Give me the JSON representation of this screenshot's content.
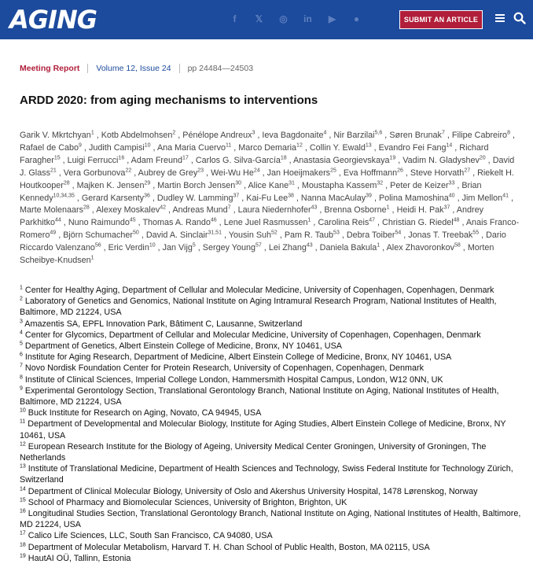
{
  "header": {
    "logo": "AGING",
    "social": [
      "facebook-icon",
      "x-icon",
      "instagram-icon",
      "linkedin-icon",
      "youtube-icon",
      "reddit-icon"
    ],
    "submit_label": "SUBMIT AN ARTICLE"
  },
  "meta": {
    "type": "Meeting Report",
    "volume": "Volume 12, Issue 24",
    "pages": "pp 24484—24503"
  },
  "title": "ARDD 2020: from aging mechanisms to interventions",
  "authors": [
    {
      "name": "Garik V. Mkrtchyan",
      "aff": "1"
    },
    {
      "name": "Kotb Abdelmohsen",
      "aff": "2"
    },
    {
      "name": "Pénélope Andreux",
      "aff": "3"
    },
    {
      "name": "Ieva Bagdonaite",
      "aff": "4"
    },
    {
      "name": "Nir Barzilai",
      "aff": "5,6"
    },
    {
      "name": "Søren Brunak",
      "aff": "7"
    },
    {
      "name": "Filipe Cabreiro",
      "aff": "8"
    },
    {
      "name": "Rafael de Cabo",
      "aff": "9"
    },
    {
      "name": "Judith Campisi",
      "aff": "10"
    },
    {
      "name": "Ana Maria Cuervo",
      "aff": "11"
    },
    {
      "name": "Marco Demaria",
      "aff": "12"
    },
    {
      "name": "Collin Y. Ewald",
      "aff": "13"
    },
    {
      "name": "Evandro Fei Fang",
      "aff": "14"
    },
    {
      "name": "Richard Faragher",
      "aff": "15"
    },
    {
      "name": "Luigi Ferrucci",
      "aff": "16"
    },
    {
      "name": "Adam Freund",
      "aff": "17"
    },
    {
      "name": "Carlos G. Silva-García",
      "aff": "18"
    },
    {
      "name": "Anastasia Georgievskaya",
      "aff": "19"
    },
    {
      "name": "Vadim N. Gladyshev",
      "aff": "20"
    },
    {
      "name": "David J. Glass",
      "aff": "21"
    },
    {
      "name": "Vera Gorbunova",
      "aff": "22"
    },
    {
      "name": "Aubrey de Grey",
      "aff": "23"
    },
    {
      "name": "Wei-Wu He",
      "aff": "24"
    },
    {
      "name": "Jan Hoeijmakers",
      "aff": "25"
    },
    {
      "name": "Eva Hoffmann",
      "aff": "26"
    },
    {
      "name": "Steve Horvath",
      "aff": "27"
    },
    {
      "name": "Riekelt H. Houtkooper",
      "aff": "28"
    },
    {
      "name": "Majken K. Jensen",
      "aff": "29"
    },
    {
      "name": "Martin Borch Jensen",
      "aff": "30"
    },
    {
      "name": "Alice Kane",
      "aff": "31"
    },
    {
      "name": "Moustapha Kassem",
      "aff": "32"
    },
    {
      "name": "Peter de Keizer",
      "aff": "33"
    },
    {
      "name": "Brian Kennedy",
      "aff": "10,34,35"
    },
    {
      "name": "Gerard Karsenty",
      "aff": "36"
    },
    {
      "name": "Dudley W. Lamming",
      "aff": "37"
    },
    {
      "name": "Kai-Fu Lee",
      "aff": "38"
    },
    {
      "name": "Nanna MacAulay",
      "aff": "39"
    },
    {
      "name": "Polina Mamoshina",
      "aff": "40"
    },
    {
      "name": "Jim Mellon",
      "aff": "41"
    },
    {
      "name": "Marte Molenaars",
      "aff": "28"
    },
    {
      "name": "Alexey Moskalev",
      "aff": "42"
    },
    {
      "name": "Andreas Mund",
      "aff": "7"
    },
    {
      "name": "Laura Niedernhofer",
      "aff": "43"
    },
    {
      "name": "Brenna Osborne",
      "aff": "1"
    },
    {
      "name": "Heidi H. Pak",
      "aff": "37"
    },
    {
      "name": "Andrey Parkhitko",
      "aff": "44"
    },
    {
      "name": "Nuno Raimundo",
      "aff": "45"
    },
    {
      "name": "Thomas A. Rando",
      "aff": "46"
    },
    {
      "name": "Lene Juel Rasmussen",
      "aff": "1"
    },
    {
      "name": "Carolina Reis",
      "aff": "47"
    },
    {
      "name": "Christian G. Riedel",
      "aff": "48"
    },
    {
      "name": "Anais Franco-Romero",
      "aff": "49"
    },
    {
      "name": "Björn Schumacher",
      "aff": "50"
    },
    {
      "name": "David A. Sinclair",
      "aff": "31,51"
    },
    {
      "name": "Yousin Suh",
      "aff": "52"
    },
    {
      "name": "Pam R. Taub",
      "aff": "53"
    },
    {
      "name": "Debra Toiber",
      "aff": "54"
    },
    {
      "name": "Jonas T. Treebak",
      "aff": "55"
    },
    {
      "name": "Dario Riccardo Valenzano",
      "aff": "56"
    },
    {
      "name": "Eric Verdin",
      "aff": "10"
    },
    {
      "name": "Jan Vijg",
      "aff": "5"
    },
    {
      "name": "Sergey Young",
      "aff": "57"
    },
    {
      "name": "Lei Zhang",
      "aff": "43"
    },
    {
      "name": "Daniela Bakula",
      "aff": "1"
    },
    {
      "name": "Alex Zhavoronkov",
      "aff": "58"
    },
    {
      "name": "Morten Scheibye-Knudsen",
      "aff": "1"
    }
  ],
  "affiliations": [
    {
      "num": "1",
      "text": "Center for Healthy Aging, Department of Cellular and Molecular Medicine, University of Copenhagen, Copenhagen, Denmark"
    },
    {
      "num": "2",
      "text": "Laboratory of Genetics and Genomics, National Institute on Aging Intramural Research Program, National Institutes of Health, Baltimore, MD 21224, USA"
    },
    {
      "num": "3",
      "text": "Amazentis SA, EPFL Innovation Park, Bâtiment C, Lausanne, Switzerland"
    },
    {
      "num": "4",
      "text": "Center for Glycomics, Department of Cellular and Molecular Medicine, University of Copenhagen, Copenhagen, Denmark"
    },
    {
      "num": "5",
      "text": "Department of Genetics, Albert Einstein College of Medicine, Bronx, NY 10461, USA"
    },
    {
      "num": "6",
      "text": "Institute for Aging Research, Department of Medicine, Albert Einstein College of Medicine, Bronx, NY 10461, USA"
    },
    {
      "num": "7",
      "text": "Novo Nordisk Foundation Center for Protein Research, University of Copenhagen, Copenhagen, Denmark"
    },
    {
      "num": "8",
      "text": "Institute of Clinical Sciences, Imperial College London, Hammersmith Hospital Campus, London, W12 0NN, UK"
    },
    {
      "num": "9",
      "text": "Experimental Gerontology Section, Translational Gerontology Branch, National Institute on Aging, National Institutes of Health, Baltimore, MD 21224, USA"
    },
    {
      "num": "10",
      "text": "Buck Institute for Research on Aging, Novato, CA 94945, USA"
    },
    {
      "num": "11",
      "text": "Department of Developmental and Molecular Biology, Institute for Aging Studies, Albert Einstein College of Medicine, Bronx, NY 10461, USA"
    },
    {
      "num": "12",
      "text": "European Research Institute for the Biology of Ageing, University Medical Center Groningen, University of Groningen, The Netherlands"
    },
    {
      "num": "13",
      "text": "Institute of Translational Medicine, Department of Health Sciences and Technology, Swiss Federal Institute for Technology Zürich, Switzerland"
    },
    {
      "num": "14",
      "text": "Department of Clinical Molecular Biology, University of Oslo and Akershus University Hospital, 1478 Lørenskog, Norway"
    },
    {
      "num": "15",
      "text": "School of Pharmacy and Biomolecular Sciences, University of Brighton, Brighton, UK"
    },
    {
      "num": "16",
      "text": "Longitudinal Studies Section, Translational Gerontology Branch, National Institute on Aging, National Institutes of Health, Baltimore, MD 21224, USA"
    },
    {
      "num": "17",
      "text": "Calico Life Sciences, LLC, South San Francisco, CA 94080, USA"
    },
    {
      "num": "18",
      "text": "Department of Molecular Metabolism, Harvard T. H. Chan School of Public Health, Boston, MA 02115, USA"
    },
    {
      "num": "19",
      "text": "HautAI OÜ, Tallinn, Estonia"
    }
  ]
}
